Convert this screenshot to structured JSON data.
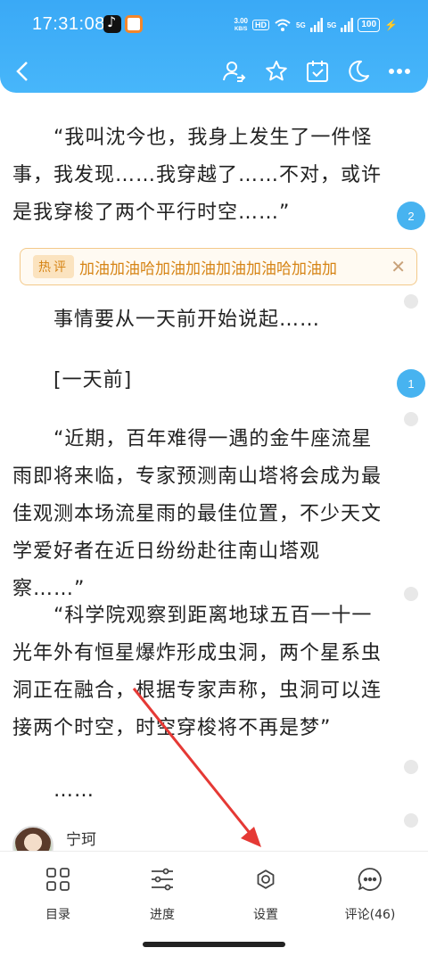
{
  "status_bar": {
    "time": "17:31:08",
    "speed_value": "3.00",
    "speed_unit": "KB/S",
    "hd": "HD",
    "signal1": "5G",
    "signal2": "5G",
    "battery": "100"
  },
  "toolbar": {
    "back_icon": "chevron-left-icon",
    "icons": [
      "user-switch-icon",
      "star-icon",
      "calendar-check-icon",
      "moon-icon",
      "more-icon"
    ]
  },
  "content": {
    "paragraphs": [
      "“我叫沈今也，我身上发生了一件怪事，我发现……我穿越了……不对，或许是我穿梭了两个平行时空……”",
      "事情要从一天前开始说起……",
      "[一天前]",
      "“近期，百年难得一遇的金牛座流星雨即将来临，专家预测南山塔将会成为最佳观测本场流星雨的最佳位置，不少天文学爱好者在近日纷纷赴往南山塔观察……”",
      "“科学院观察到距离地球五百一十一光年外有恒星爆炸形成虫洞，两个星系虫洞正在融合，根据专家声称，虫洞可以连接两个时空，时空穿梭将不再是梦”",
      "……"
    ],
    "hot_comment": {
      "tag": "热评",
      "text": "加油加油哈加油加油加油加油哈加油加"
    },
    "comment_counts": [
      "2",
      "1"
    ],
    "author_name": "宁珂"
  },
  "bottom_nav": {
    "items": [
      {
        "label": "目录",
        "icon": "grid-icon"
      },
      {
        "label": "进度",
        "icon": "sliders-icon"
      },
      {
        "label": "设置",
        "icon": "gear-icon"
      },
      {
        "label": "评论(46)",
        "icon": "chat-icon"
      }
    ]
  },
  "colors": {
    "header": "#3aa9f6",
    "bubble": "#47b3f0",
    "hot_comment": "#d68415",
    "annotation_arrow": "#e53935"
  }
}
